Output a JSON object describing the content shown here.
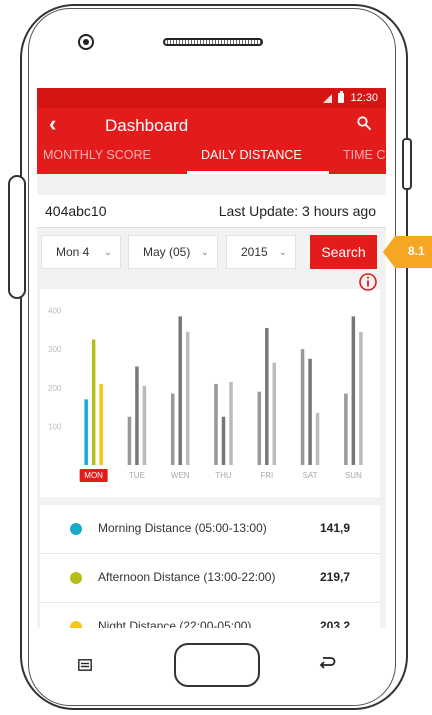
{
  "status": {
    "time": "12:30"
  },
  "appbar": {
    "back": "‹",
    "title": "Dashboard",
    "search_icon": "search-icon"
  },
  "tabs": [
    {
      "label": "MONTHLY SCORE",
      "active": false
    },
    {
      "label": "DAILY DISTANCE",
      "active": true
    },
    {
      "label": "TIME C",
      "active": false
    }
  ],
  "device": {
    "id": "404abc10",
    "last_update": "Last Update: 3 hours ago"
  },
  "filters": {
    "day": "Mon 4",
    "month": "May (05)",
    "year": "2015",
    "search_label": "Search"
  },
  "callout": {
    "label": "8.1",
    "color": "#f5a623"
  },
  "colors": {
    "brand": "#e31b1b",
    "morning": "#1aa9c9",
    "afternoon": "#b5bd1b",
    "night": "#f5c518"
  },
  "chart_data": {
    "type": "bar",
    "categories": [
      "MON",
      "TUE",
      "WEN",
      "THU",
      "FRI",
      "SAT",
      "SUN"
    ],
    "selected_category": "MON",
    "ylim": [
      0,
      430
    ],
    "yticks": [
      100,
      200,
      300,
      400
    ],
    "series_colors": [
      [
        "#1aa9c9",
        "#b5bd1b",
        "#f5c518"
      ],
      [
        "#999999",
        "#777777",
        "#bbbbbb"
      ]
    ],
    "series": [
      {
        "values": [
          170,
          125,
          185,
          210,
          190,
          300,
          185
        ]
      },
      {
        "values": [
          325,
          255,
          385,
          125,
          355,
          275,
          385
        ]
      },
      {
        "values": [
          210,
          205,
          345,
          215,
          265,
          135,
          345
        ]
      }
    ]
  },
  "legend": [
    {
      "label": "Morning Distance (05:00-13:00)",
      "value": "141,9"
    },
    {
      "label": "Afternoon Distance (13:00-22:00)",
      "value": "219,7"
    },
    {
      "label": "Night Distance (22:00-05:00)",
      "value": "203,2"
    }
  ]
}
